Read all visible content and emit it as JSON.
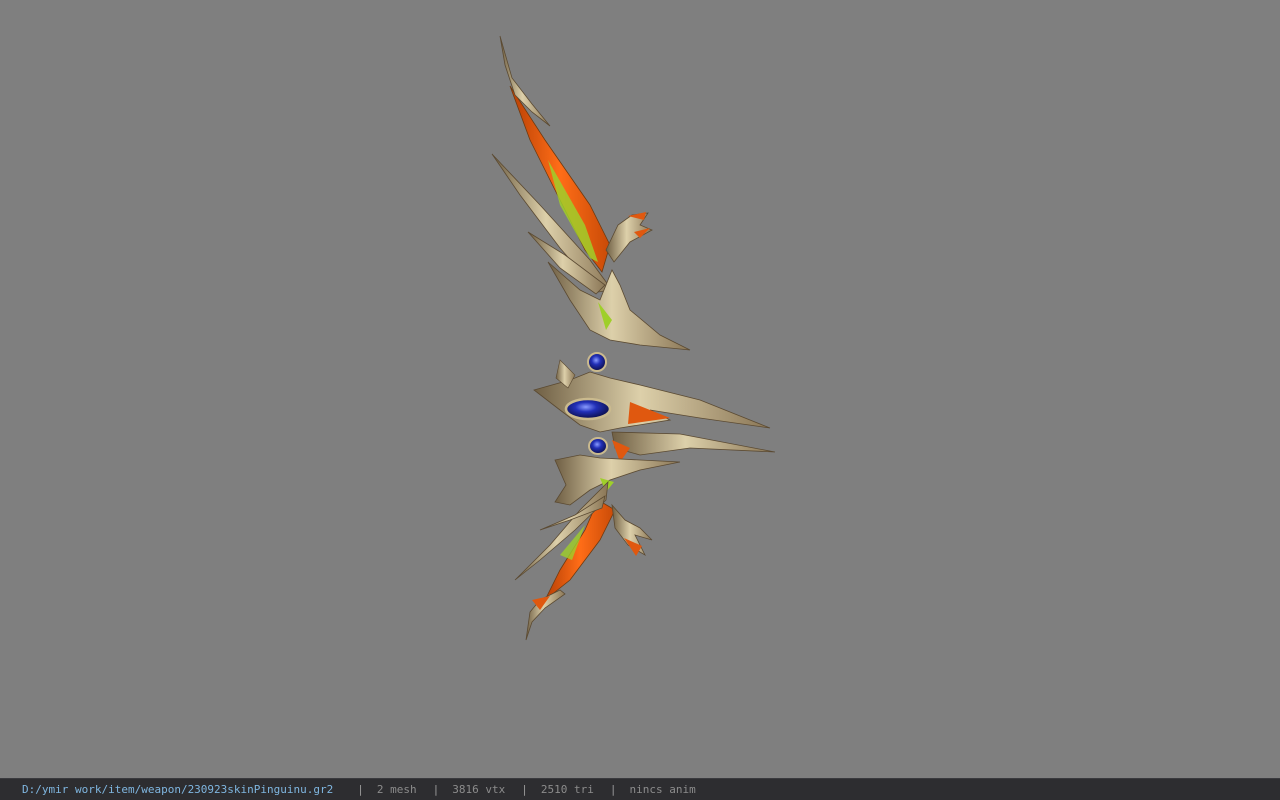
{
  "viewport": {
    "background_color": "#7f7f7f",
    "model": {
      "description_icon": "bow-model",
      "colors": {
        "gold": "#b8a27a",
        "gold_light": "#ddd0aa",
        "gold_dark": "#6f5f44",
        "orange": "#e0580f",
        "green": "#9fcf2a",
        "gem_blue": "#1a1f8a"
      }
    }
  },
  "status_bar": {
    "file_path": "D:/ymir work/item/weapon/230923skinPinguinu.gr2",
    "separator": "|",
    "mesh_count": "2 mesh",
    "vertex_count": "3816 vtx",
    "triangle_count": "2510 tri",
    "anim_status": "nincs anim"
  }
}
